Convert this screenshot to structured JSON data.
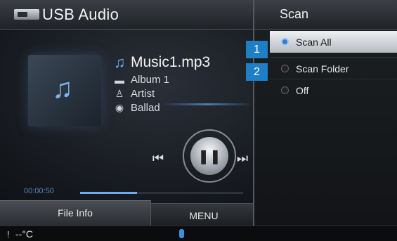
{
  "header": {
    "title": "USB Audio",
    "icon": "usb-drive-icon"
  },
  "track": {
    "title": "Music1.mp3",
    "album": "Album 1",
    "artist": "Artist",
    "genre": "Ballad"
  },
  "playback": {
    "time": "00:00:50",
    "progress": 0.35
  },
  "tabs": {
    "file_info": "File Info",
    "menu": "MENU"
  },
  "status_bar": {
    "temperature": "--°C"
  },
  "scan_menu": {
    "title": "Scan",
    "options": [
      {
        "label": "Scan All",
        "selected": true
      },
      {
        "label": "Scan Folder",
        "selected": false
      },
      {
        "label": "Off",
        "selected": false
      }
    ]
  },
  "callouts": [
    "1",
    "2"
  ],
  "colors": {
    "accent": "#1e7fc6",
    "progress": "#6aaef0"
  }
}
